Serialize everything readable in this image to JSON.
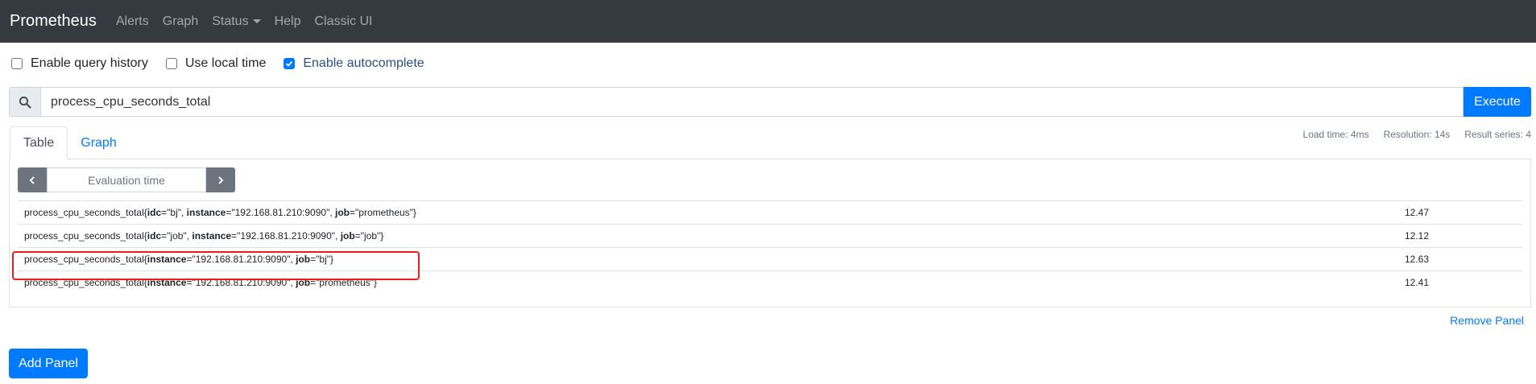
{
  "navbar": {
    "brand": "Prometheus",
    "links": [
      "Alerts",
      "Graph",
      "Status",
      "Help",
      "Classic UI"
    ]
  },
  "options": [
    {
      "label": "Enable query history",
      "checked": false
    },
    {
      "label": "Use local time",
      "checked": false
    },
    {
      "label": "Enable autocomplete",
      "checked": true
    }
  ],
  "query": {
    "value": "process_cpu_seconds_total",
    "execute_label": "Execute"
  },
  "tabs": [
    "Table",
    "Graph"
  ],
  "stats": {
    "load_time": "Load time: 4ms",
    "resolution": "Resolution: 14s",
    "result_series": "Result series: 4"
  },
  "table": {
    "evaluation_time_placeholder": "Evaluation time",
    "rows": [
      {
        "metric": "process_cpu_seconds_total",
        "labels": [
          {
            "name": "idc",
            "value": "\"bj\""
          },
          {
            "name": "instance",
            "value": "\"192.168.81.210:9090\""
          },
          {
            "name": "job",
            "value": "\"prometheus\""
          }
        ],
        "value": "12.47"
      },
      {
        "metric": "process_cpu_seconds_total",
        "labels": [
          {
            "name": "idc",
            "value": "\"job\""
          },
          {
            "name": "instance",
            "value": "\"192.168.81.210:9090\""
          },
          {
            "name": "job",
            "value": "\"job\""
          }
        ],
        "value": "12.12"
      },
      {
        "metric": "process_cpu_seconds_total",
        "labels": [
          {
            "name": "instance",
            "value": "\"192.168.81.210:9090\""
          },
          {
            "name": "job",
            "value": "\"bj\""
          }
        ],
        "value": "12.63"
      },
      {
        "metric": "process_cpu_seconds_total",
        "labels": [
          {
            "name": "instance",
            "value": "\"192.168.81.210:9090\""
          },
          {
            "name": "job",
            "value": "\"prometheus\""
          }
        ],
        "value": "12.41"
      }
    ]
  },
  "remove_panel_label": "Remove Panel",
  "add_panel_label": "Add Panel",
  "colors": {
    "navbar": "#343a40",
    "primary": "#007bff",
    "highlight": "#ef1c1c"
  }
}
